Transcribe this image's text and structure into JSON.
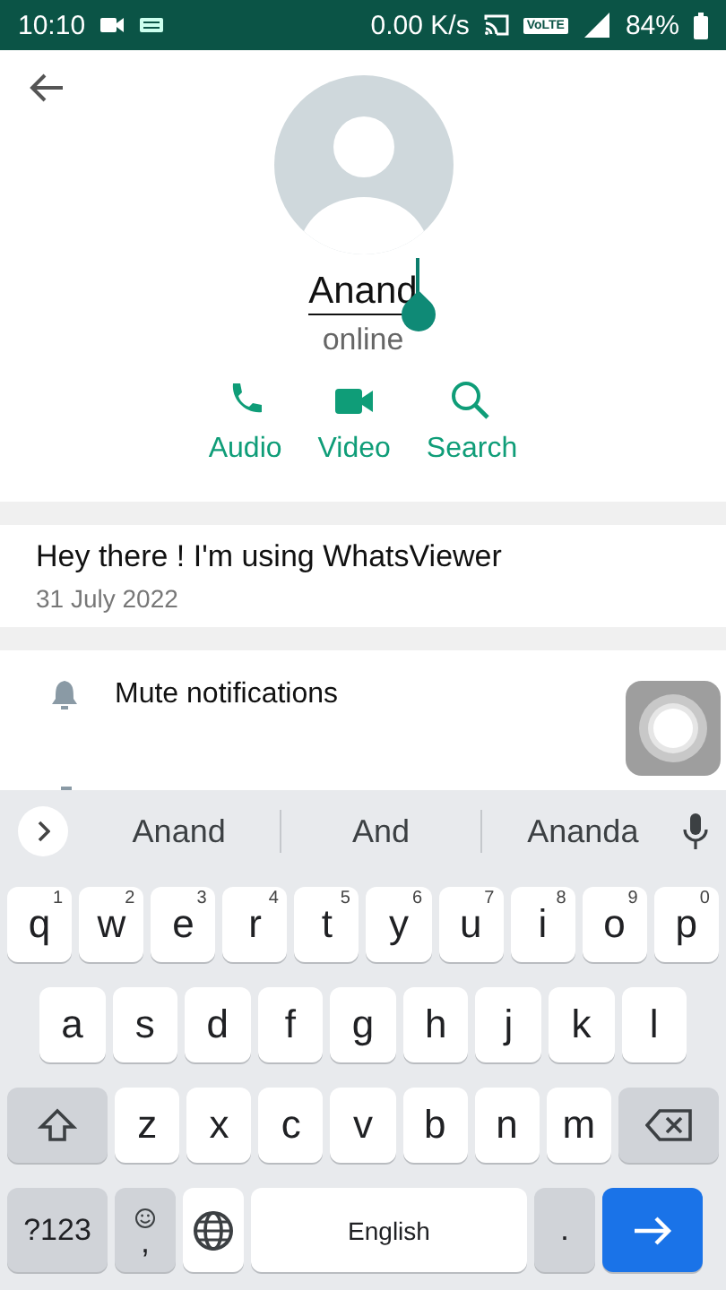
{
  "status_bar": {
    "time": "10:10",
    "speed": "0.00 K/s",
    "volte": "VoLTE",
    "battery": "84%"
  },
  "profile": {
    "name": "Anand",
    "editing": true,
    "status": "online",
    "actions": [
      {
        "kind": "audio",
        "label": "Audio"
      },
      {
        "kind": "video",
        "label": "Video"
      },
      {
        "kind": "search",
        "label": "Search"
      }
    ]
  },
  "about": {
    "text": "Hey there ! I'm using WhatsViewer",
    "date": "31 July 2022"
  },
  "settings": [
    {
      "kind": "mute",
      "label": "Mute notifications"
    },
    {
      "kind": "custom"
    }
  ],
  "keyboard": {
    "suggestions": [
      "Anand",
      "And",
      "Ananda"
    ],
    "letter_rows": [
      [
        {
          "label": "q",
          "hint": "1"
        },
        {
          "label": "w",
          "hint": "2"
        },
        {
          "label": "e",
          "hint": "3"
        },
        {
          "label": "r",
          "hint": "4"
        },
        {
          "label": "t",
          "hint": "5"
        },
        {
          "label": "y",
          "hint": "6"
        },
        {
          "label": "u",
          "hint": "7"
        },
        {
          "label": "i",
          "hint": "8"
        },
        {
          "label": "o",
          "hint": "9"
        },
        {
          "label": "p",
          "hint": "0"
        }
      ],
      [
        {
          "label": "a"
        },
        {
          "label": "s"
        },
        {
          "label": "d"
        },
        {
          "label": "f"
        },
        {
          "label": "g"
        },
        {
          "label": "h"
        },
        {
          "label": "j"
        },
        {
          "label": "k"
        },
        {
          "label": "l"
        }
      ],
      [
        {
          "kind": "shift"
        },
        {
          "label": "z"
        },
        {
          "label": "x"
        },
        {
          "label": "c"
        },
        {
          "label": "v"
        },
        {
          "label": "b"
        },
        {
          "label": "n"
        },
        {
          "label": "m"
        },
        {
          "kind": "backspace"
        }
      ]
    ],
    "bottom_row": [
      {
        "kind": "symbols",
        "label": "?123"
      },
      {
        "kind": "emoji",
        "label": ","
      },
      {
        "kind": "globe"
      },
      {
        "kind": "space",
        "label": "English"
      },
      {
        "kind": "period",
        "label": "."
      },
      {
        "kind": "enter"
      }
    ]
  }
}
